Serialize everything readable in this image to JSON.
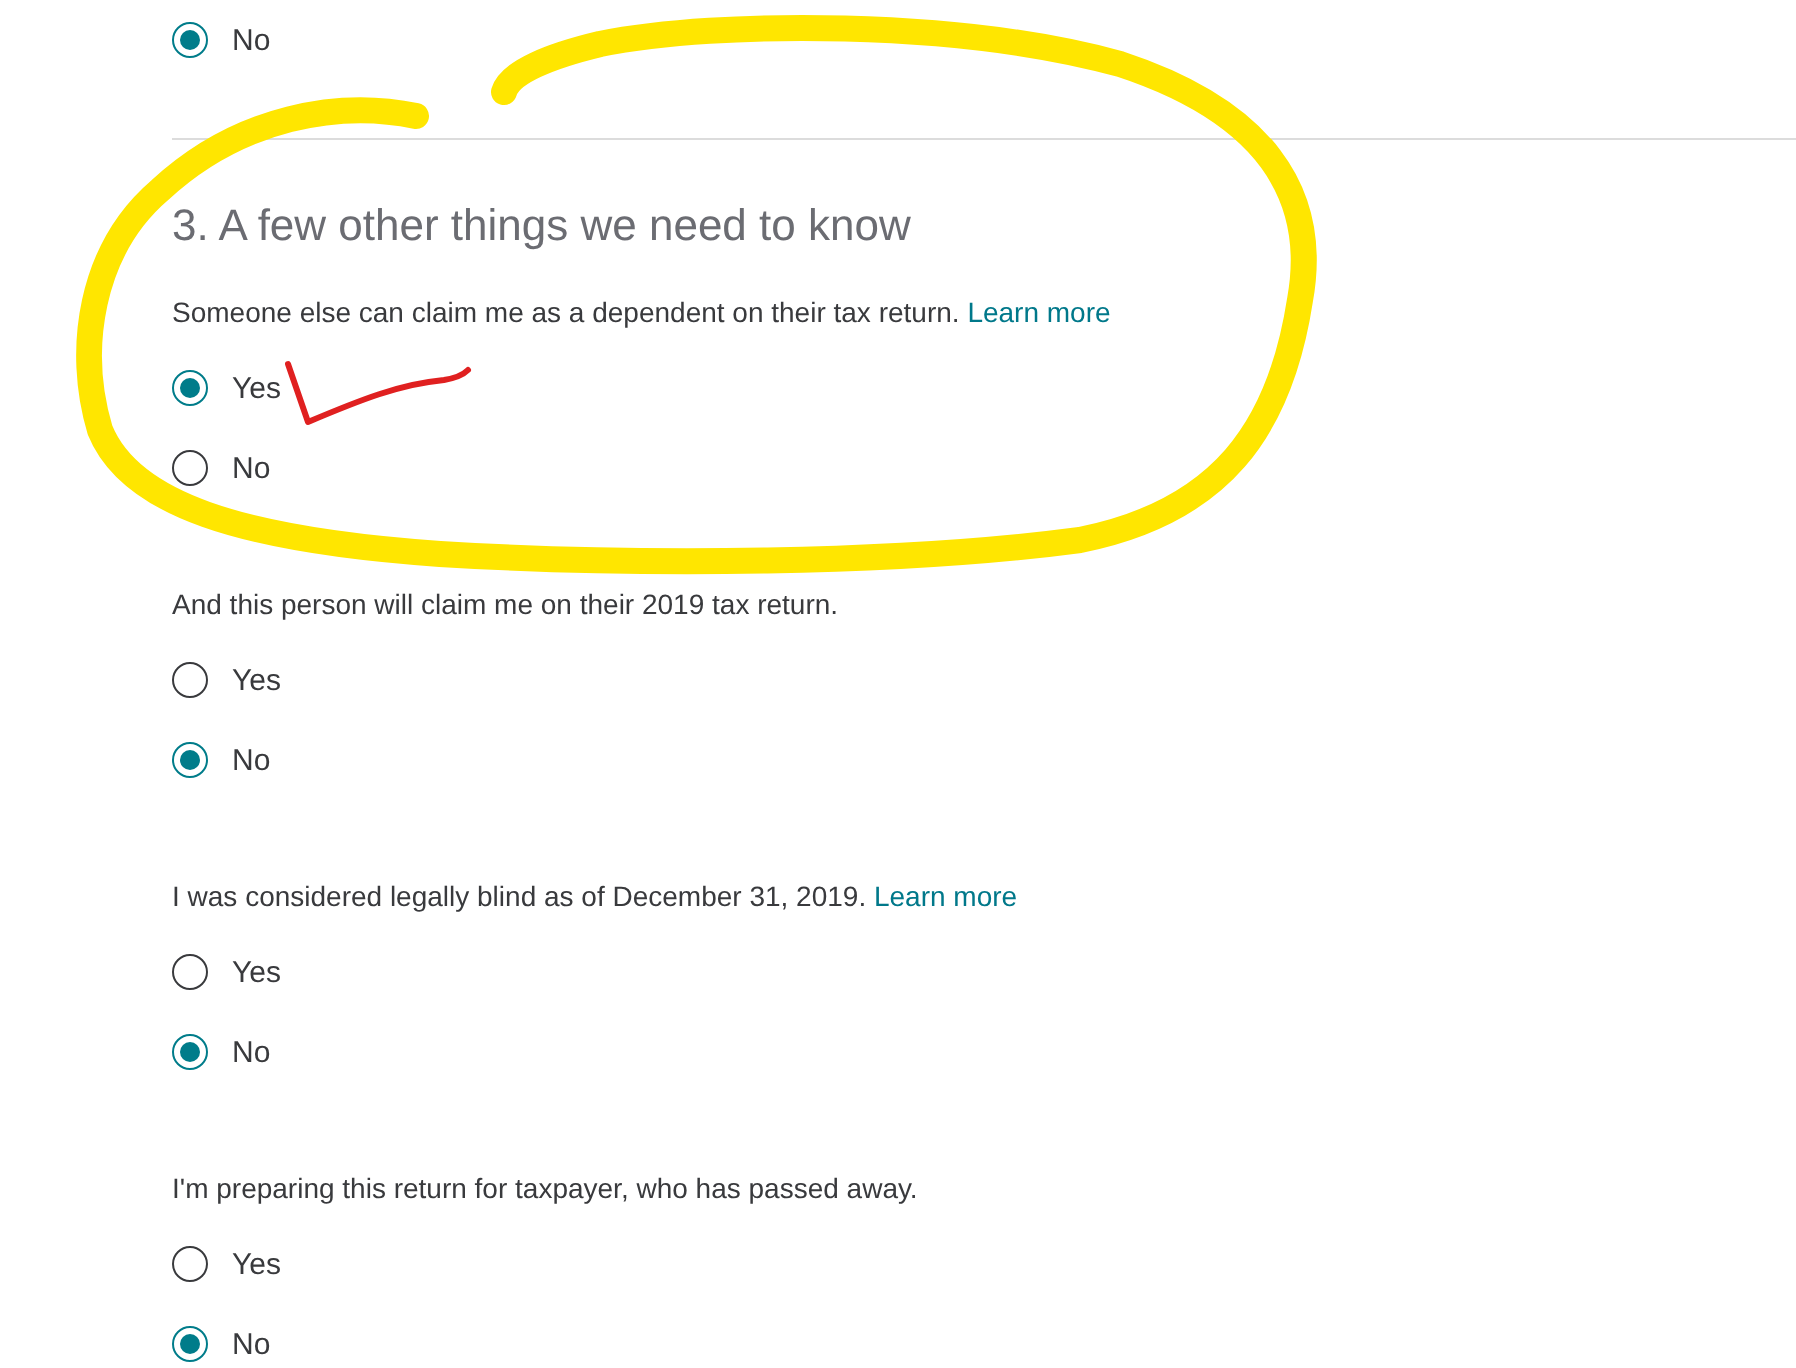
{
  "previous_option": {
    "label": "No",
    "selected": true
  },
  "section": {
    "heading": "3. A few other things we need to know",
    "questions": [
      {
        "text": "Someone else can claim me as a dependent on their tax return.",
        "link": "Learn more",
        "options": [
          {
            "label": "Yes",
            "selected": true
          },
          {
            "label": "No",
            "selected": false
          }
        ]
      },
      {
        "text": "And this person will claim me on their 2019 tax return.",
        "options": [
          {
            "label": "Yes",
            "selected": false
          },
          {
            "label": "No",
            "selected": true
          }
        ]
      },
      {
        "text": "I was considered legally blind as of December 31, 2019.",
        "link": "Learn more",
        "options": [
          {
            "label": "Yes",
            "selected": false
          },
          {
            "label": "No",
            "selected": true
          }
        ]
      },
      {
        "text": "I'm preparing this return for taxpayer, who has passed away.",
        "options": [
          {
            "label": "Yes",
            "selected": false
          },
          {
            "label": "No",
            "selected": true
          }
        ]
      }
    ]
  }
}
